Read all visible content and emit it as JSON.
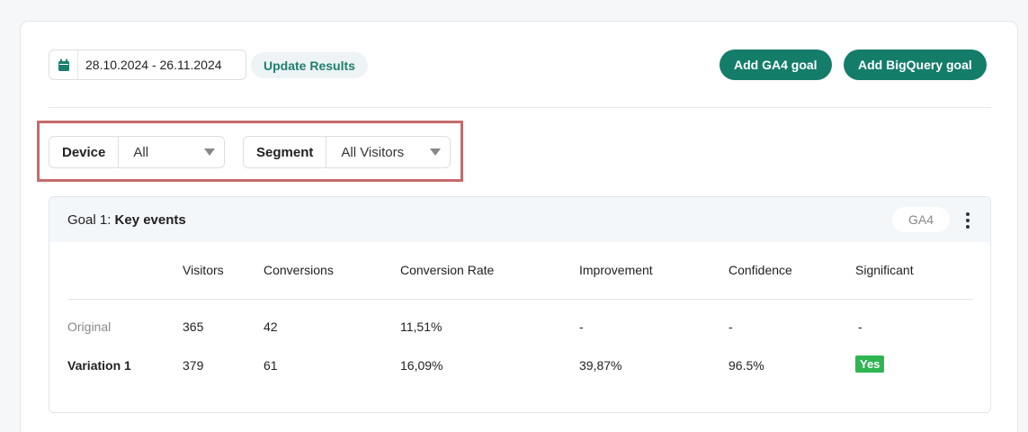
{
  "toolbar": {
    "date_range": "28.10.2024 - 26.11.2024",
    "update_label": "Update Results",
    "add_ga4_label": "Add GA4 goal",
    "add_bigquery_label": "Add BigQuery goal"
  },
  "filters": {
    "device": {
      "label": "Device",
      "value": "All"
    },
    "segment": {
      "label": "Segment",
      "value": "All Visitors"
    }
  },
  "goal": {
    "prefix": "Goal 1: ",
    "name": "Key events",
    "badge": "GA4"
  },
  "table": {
    "headers": [
      "Visitors",
      "Conversions",
      "Conversion Rate",
      "Improvement",
      "Confidence",
      "Significant"
    ],
    "rows": [
      {
        "label": "Original",
        "visitors": "365",
        "conversions": "42",
        "rate": "11,51%",
        "improvement": "-",
        "confidence": "-",
        "significant": "-"
      },
      {
        "label": "Variation 1",
        "visitors": "379",
        "conversions": "61",
        "rate": "16,09%",
        "improvement": "39,87%",
        "confidence": "96.5%",
        "significant": "Yes"
      }
    ]
  },
  "colors": {
    "primary": "#137d6a",
    "highlight": "#c56b6b",
    "yes_badge": "#2fb552"
  }
}
